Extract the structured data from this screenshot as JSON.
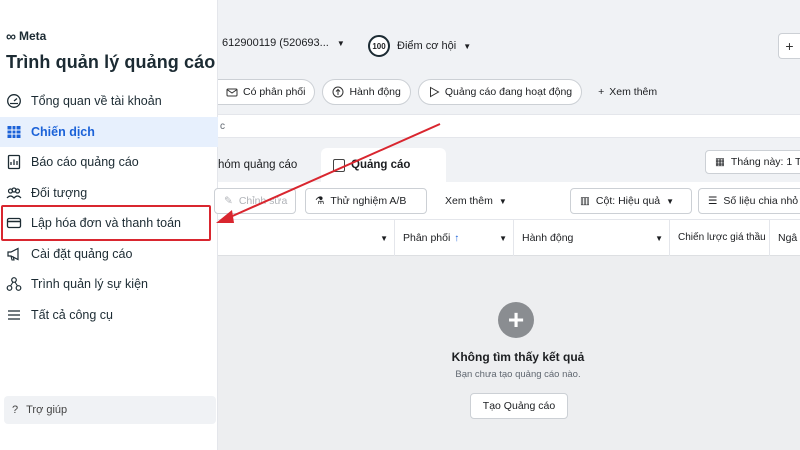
{
  "brand": {
    "logo_text": "Meta"
  },
  "sidebar": {
    "title": "Trình quản lý quảng cáo",
    "items": [
      {
        "label": "Tổng quan về tài khoản",
        "icon": "dashboard-icon"
      },
      {
        "label": "Chiến dịch",
        "icon": "table-icon",
        "active": true
      },
      {
        "label": "Báo cáo quảng cáo",
        "icon": "report-icon"
      },
      {
        "label": "Đối tượng",
        "icon": "audience-icon"
      },
      {
        "label": "Lập hóa đơn và thanh toán",
        "icon": "credit-card-icon",
        "highlighted": true
      },
      {
        "label": "Cài đặt quảng cáo",
        "icon": "megaphone-icon"
      },
      {
        "label": "Trình quản lý sự kiện",
        "icon": "events-icon"
      },
      {
        "label": "Tất cả công cụ",
        "icon": "menu-icon"
      }
    ],
    "help": "Trợ giúp"
  },
  "topbar": {
    "account": "612900119 (520693...",
    "score_value": "100",
    "score_label": "Điểm cơ hội"
  },
  "chips": [
    {
      "label": "Có phân phối",
      "icon": "delivery-icon"
    },
    {
      "label": "Hành động",
      "icon": "action-icon"
    },
    {
      "label": "Quảng cáo đang hoạt động",
      "icon": "play-icon"
    },
    {
      "label": "Xem thêm",
      "icon": "plus-icon"
    }
  ],
  "search_fragment": "c",
  "tabs": {
    "ad_sets": "hóm quảng cáo",
    "ads": "Quảng cáo",
    "date": "Tháng này: 1 T"
  },
  "toolbar": {
    "edit": "Chỉnh sửa",
    "ab_test": "Thử nghiệm A/B",
    "more": "Xem thêm",
    "columns": "Cột: Hiệu quả",
    "breakdown": "Số liệu chia nhỏ"
  },
  "table": {
    "headers": [
      "",
      "Phân phối",
      "Hành động",
      "Chiến lược giá thầu",
      "Ngâ"
    ]
  },
  "empty": {
    "title": "Không tìm thấy kết quả",
    "subtitle": "Bạn chưa tạo quảng cáo nào.",
    "button": "Tạo Quảng cáo"
  },
  "colors": {
    "accent": "#1b62d8",
    "highlight": "#d9262f",
    "active_bg": "#e7f0fd"
  }
}
